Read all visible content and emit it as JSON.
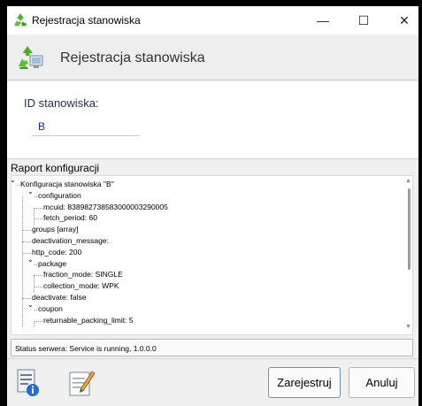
{
  "window": {
    "title": "Rejestracja stanowiska",
    "minimize": "—",
    "maximize": "☐",
    "close": "✕",
    "app_icon": "recycle-icon"
  },
  "header": {
    "title": "Rejestracja stanowiska",
    "icon": "recycle-computer-icon"
  },
  "form": {
    "id_label": "ID stanowiska:",
    "id_value": "B"
  },
  "report": {
    "label": "Raport konfiguracji",
    "tree": [
      {
        "text": "Konfiguracja stanowiska \"B\"",
        "expand": "expanded",
        "level": 0
      },
      {
        "text": "configuration",
        "expand": "expanded",
        "level": 1
      },
      {
        "text": "mcuid: 8389827385830000032900​05",
        "expand": "none",
        "level": 2
      },
      {
        "text": "fetch_period: 60",
        "expand": "none",
        "level": 2
      },
      {
        "text": "groups [array]",
        "expand": "none",
        "level": 1
      },
      {
        "text": "deactivation_message:",
        "expand": "none",
        "level": 1
      },
      {
        "text": "http_code: 200",
        "expand": "none",
        "level": 1
      },
      {
        "text": "package",
        "expand": "expanded",
        "level": 1
      },
      {
        "text": "fraction_mode: SINGLE",
        "expand": "none",
        "level": 2
      },
      {
        "text": "collection_mode: WPK",
        "expand": "none",
        "level": 2
      },
      {
        "text": "deactivate: false",
        "expand": "none",
        "level": 1
      },
      {
        "text": "coupon",
        "expand": "expanded",
        "level": 1
      },
      {
        "text": "returnable_packing_limit: 5",
        "expand": "none",
        "level": 2
      }
    ]
  },
  "status": {
    "text": "Status serwera: Service is running, 1.0.0.0"
  },
  "footer": {
    "info_icon": "document-info-icon",
    "edit_icon": "notepad-edit-icon",
    "register_label": "Zarejestruj",
    "cancel_label": "Anuluj"
  }
}
